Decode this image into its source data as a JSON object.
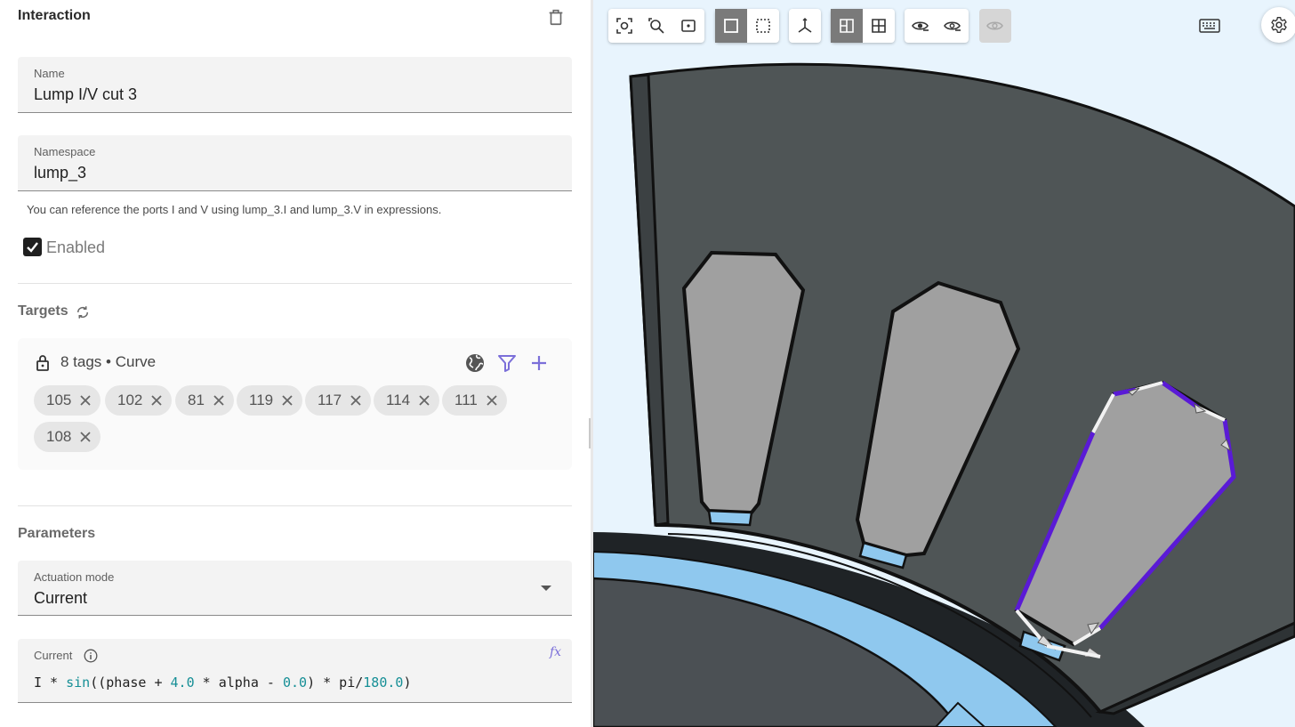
{
  "panel": {
    "title": "Interaction"
  },
  "name_field": {
    "label": "Name",
    "value": "Lump I/V cut 3"
  },
  "namespace_field": {
    "label": "Namespace",
    "value": "lump_3"
  },
  "helper_text": "You can reference the ports I and V using lump_3.I and lump_3.V in expressions.",
  "enabled": {
    "label": "Enabled",
    "checked": true
  },
  "targets": {
    "title": "Targets",
    "summary": "8 tags • Curve",
    "tags": [
      "105",
      "102",
      "81",
      "119",
      "117",
      "114",
      "111",
      "108"
    ]
  },
  "parameters": {
    "title": "Parameters",
    "actuation_mode": {
      "label": "Actuation mode",
      "value": "Current"
    },
    "current": {
      "label": "Current",
      "fx": "fx",
      "expression_parts": [
        "I * ",
        "sin",
        "((phase + ",
        "4.0",
        " * alpha - ",
        "0.0",
        ") * pi/",
        "180.0",
        ")"
      ]
    }
  },
  "viewport": {
    "background_color": "#e8f4fd",
    "selection_color": "#5a1ad6",
    "toolbar_icons": [
      [
        "zoom-fit-icon",
        "zoom-region-icon",
        "zoom-selection-icon"
      ],
      [
        "solid-select-icon",
        "box-select-icon"
      ],
      [
        "axes-icon"
      ],
      [
        "split-view-icon",
        "quad-view-icon"
      ],
      [
        "eye-hide-icon",
        "eye-show-icon"
      ],
      [
        "eye-disabled-icon"
      ]
    ]
  }
}
